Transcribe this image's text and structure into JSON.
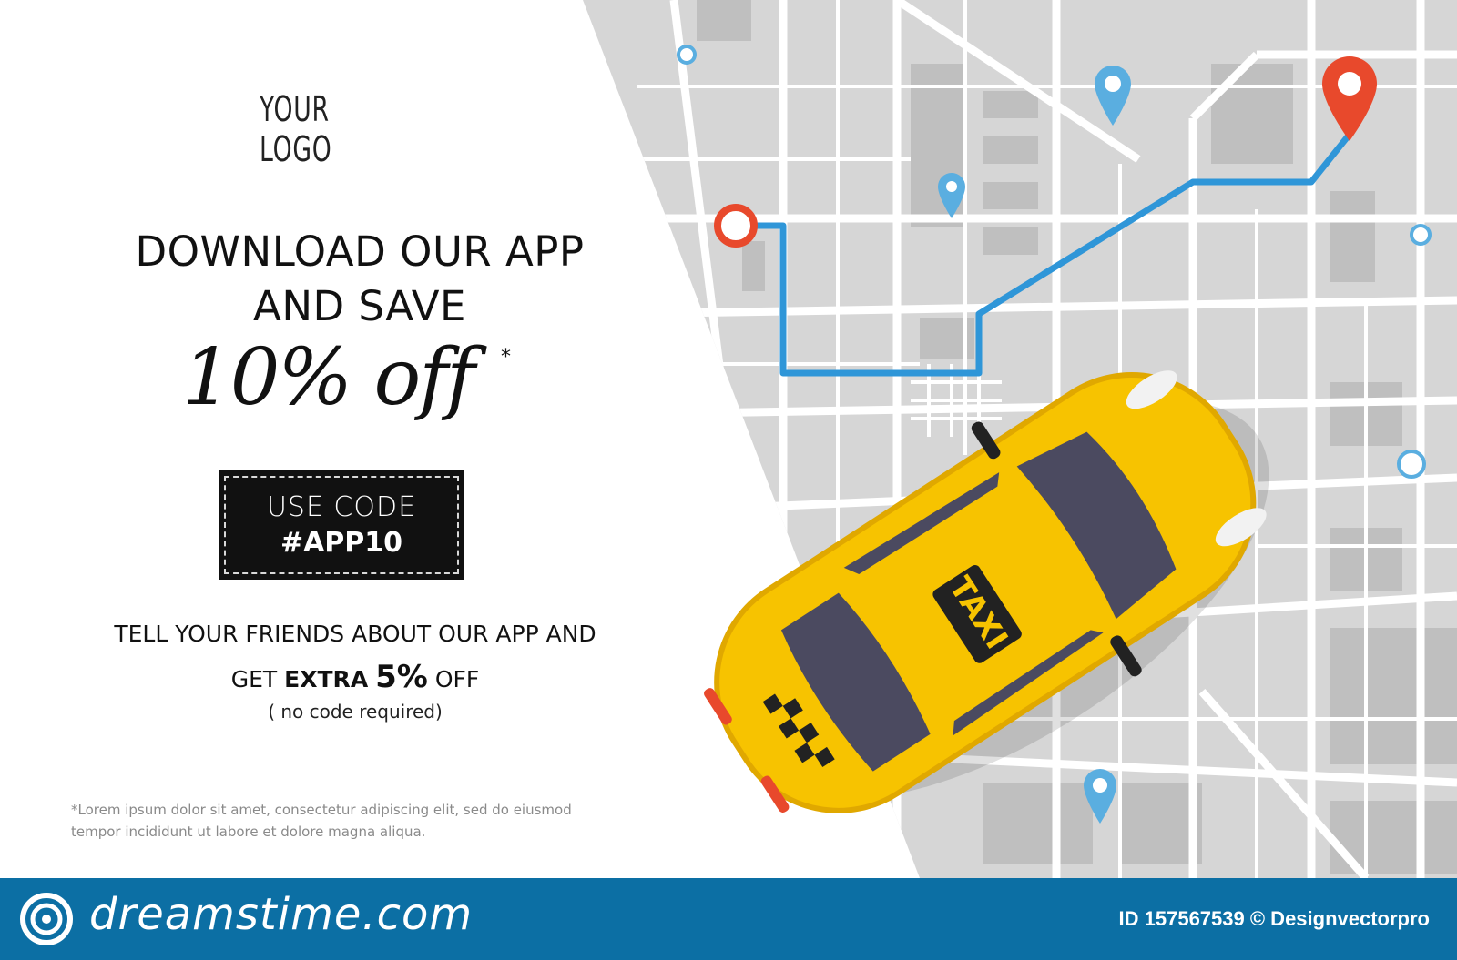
{
  "banner": {
    "logo_text": "YOUR LOGO",
    "headline_line1": "DOWNLOAD OUR APP",
    "headline_line2": "AND SAVE",
    "offer": "10% off",
    "offer_asterisk": "*",
    "code_label": "USE CODE",
    "code_value": "#APP10",
    "tell_line": "TELL YOUR FRIENDS ABOUT OUR APP AND",
    "get_word": "GET",
    "extra_word": "EXTRA",
    "extra_percent": "5%",
    "off_word": "OFF",
    "no_code": "( no code required)",
    "fine_line1": "*Lorem ipsum dolor sit amet, consectetur adipiscing elit, sed do eiusmod",
    "fine_line2": "tempor incididunt ut labore et dolore magna aliqua.",
    "taxi_roof_sign": "TAXI"
  },
  "footer": {
    "brand": "dreamstime.com",
    "credit": "ID 157567539 © Designvectorpro"
  },
  "colors": {
    "map_bg": "#d6d6d6",
    "road": "#ffffff",
    "block": "#bdbdbd",
    "route": "#2f96d8",
    "pin_red": "#e8492c",
    "pin_blue": "#5aaee0",
    "taxi_yellow": "#f7c300",
    "footer_blue": "#0c6fa4"
  }
}
